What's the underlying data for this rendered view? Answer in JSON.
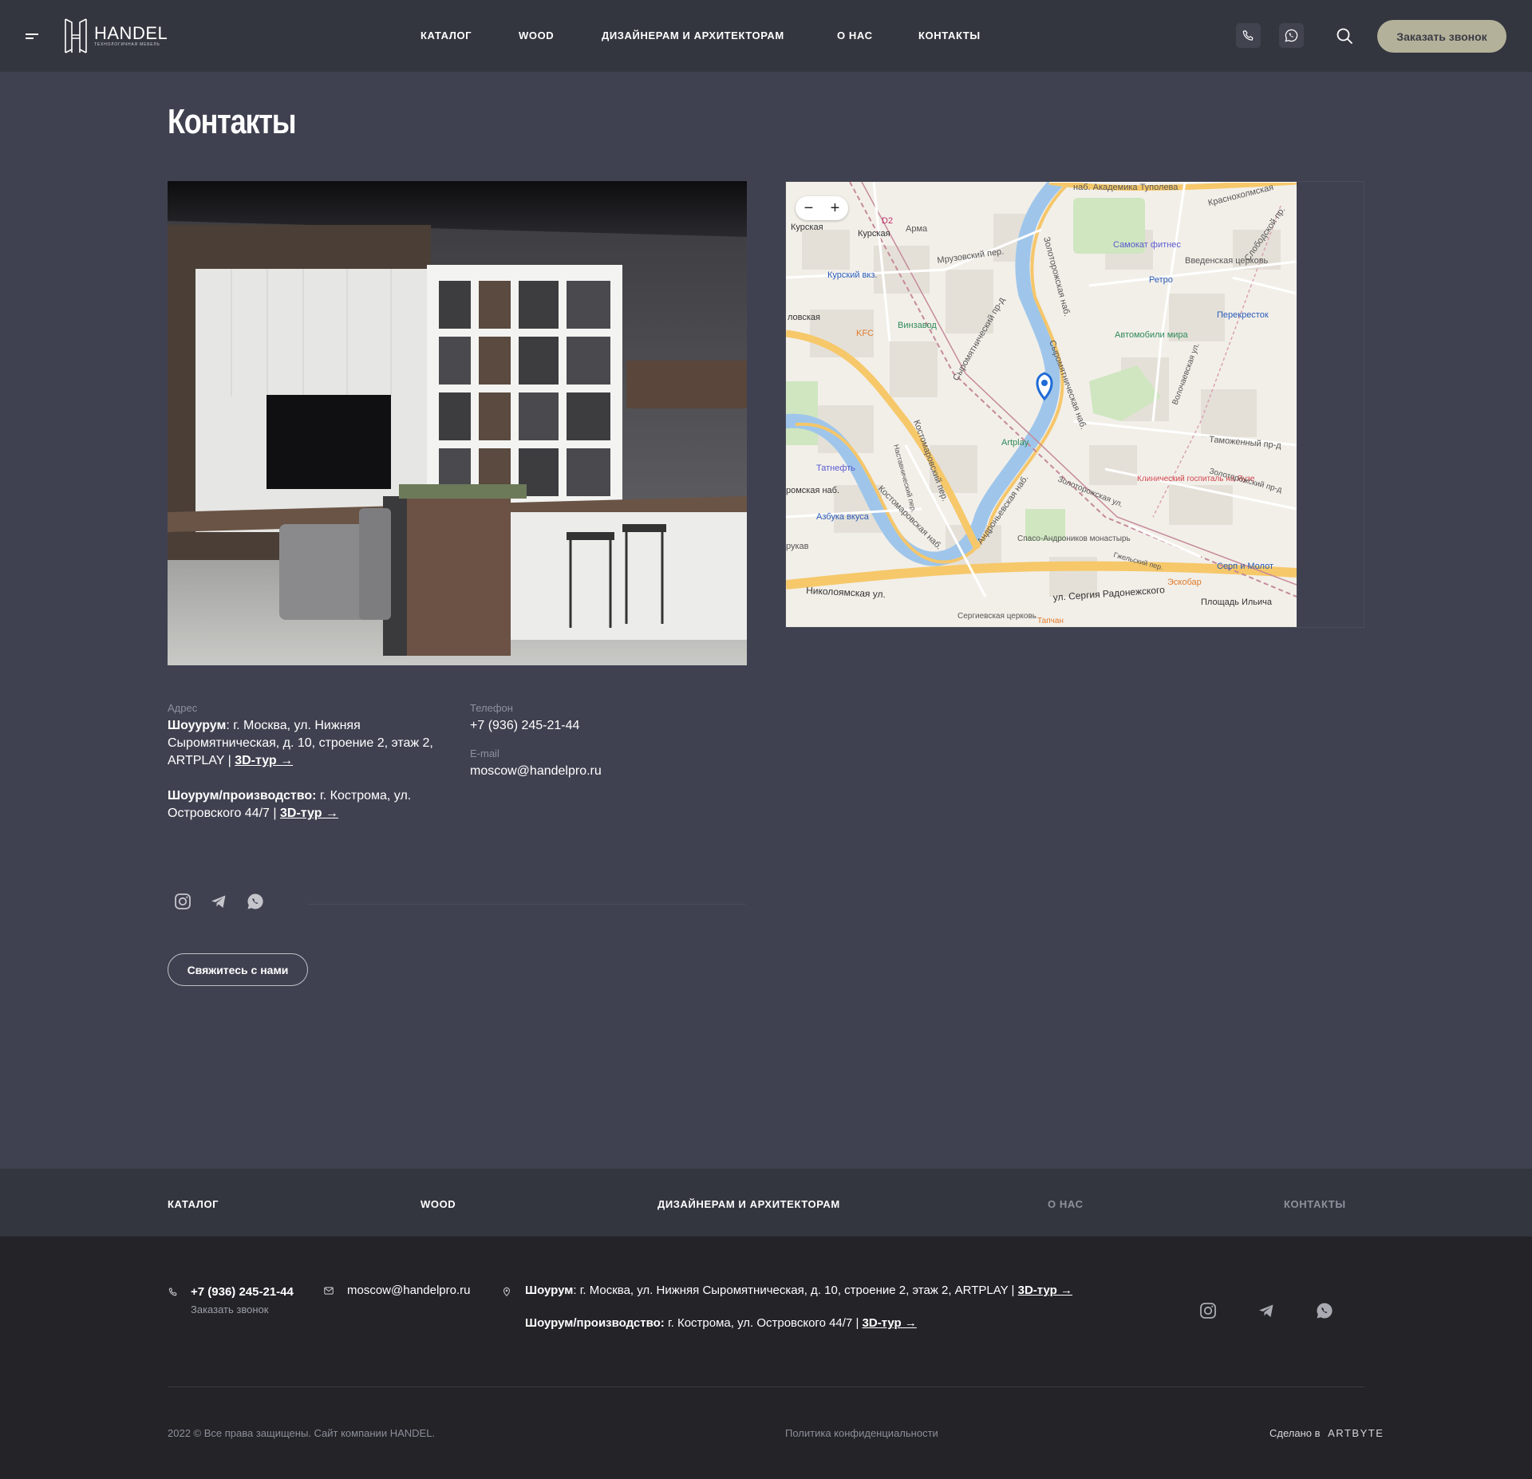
{
  "header": {
    "logo_name": "HANDEL",
    "logo_sub": "технологичная мебель",
    "nav": [
      "КАТАЛОГ",
      "WOOD",
      "ДИЗАЙНЕРАМ И АРХИТЕКТОРАМ",
      "О НАС",
      "КОНТАКТЫ"
    ],
    "call_button": "Заказать звонок"
  },
  "main": {
    "title": "Контакты",
    "address_label": "Адрес",
    "showroom_label": "Шоуурум",
    "showroom_address": ": г. Москва, ул. Нижняя Сыромятническая, д. 10, строение 2, этаж 2, ARTPLAY | ",
    "tour_link": "3D-тур →",
    "production_label": "Шоурум/производство:",
    "production_address": " г. Кострома, ул. Островского 44/7 | ",
    "phone_label": "Телефон",
    "phone": "+7 (936) 245-21-44",
    "email_label": "E-mail",
    "email": "moscow@handelpro.ru",
    "contact_button": "Свяжитесь с нами"
  },
  "map": {
    "zoom_out": "−",
    "zoom_in": "+",
    "labels": [
      "наб. Академика Туполева",
      "Краснохолмская",
      "Курская",
      "Курская",
      "D2",
      "Арма",
      "Курский вкз.",
      "Самокат фитнес",
      "Введенская церковь",
      "Слободской пр.",
      "Ретро",
      "Мрузовский пер.",
      "Золоторожская наб.",
      "ловская",
      "KFC",
      "Винзавод",
      "Перекресток",
      "Автомобили мира",
      "Сыромятнический пр-д",
      "Сыромятническая наб.",
      "Artplay",
      "Таможенный пр-д",
      "Татнефть",
      "Костомаровский пер.",
      "Наставнический пер.",
      "Клинический госпиталь на Яузе",
      "Золоторожский пр-д",
      "Золоторожская ул.",
      "ромская наб.",
      "Андроньевская наб.",
      "Азбука вкуса",
      "Костомаровская наб.",
      "Спасо-Андроников монастырь",
      "Гжельский пер.",
      "Серп и Молот",
      "Эскобар",
      "рукав",
      "Николоямская ул.",
      "ул. Сергия Радонежского",
      "Площадь Ильича",
      "Сергиевская церковь",
      "Тапчан",
      "Волочаевская ул."
    ]
  },
  "footer_nav": [
    "КАТАЛОГ",
    "WOOD",
    "ДИЗАЙНЕРАМ И АРХИТЕКТОРАМ",
    "О НАС",
    "КОНТАКТЫ"
  ],
  "footer": {
    "phone": "+7 (936) 245-21-44",
    "phone_sub": "Заказать звонок",
    "email": "moscow@handelpro.ru",
    "showroom_label": "Шоурум",
    "showroom_address": ": г. Москва, ул. Нижняя Сыромятническая, д. 10, строение 2, этаж 2, ARTPLAY | ",
    "tour_link": "3D-тур →",
    "production_label": "Шоурум/производство:",
    "production_address": " г. Кострома, ул. Островского 44/7 | ",
    "copyright": "2022 © Все права защищены. Сайт компании HANDEL.",
    "policy": "Политика конфиденциальности",
    "made_in": "Сделано в",
    "made_brand": "ARTBYTE"
  },
  "colors": {
    "page_bg": "#3f4150",
    "header_bg": "#34363f",
    "footer_bg": "#232328",
    "accent_button": "#b4b19a"
  },
  "icons": [
    "menu-icon",
    "phone-icon",
    "whatsapp-icon",
    "search-icon",
    "instagram-icon",
    "telegram-icon",
    "mail-icon",
    "location-icon",
    "map-pin-icon"
  ]
}
